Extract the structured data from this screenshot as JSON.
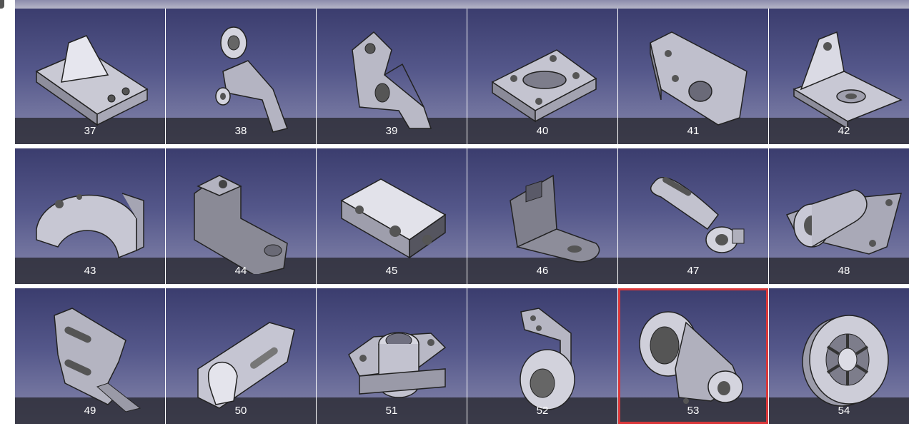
{
  "gallery": {
    "selected_index": 16,
    "accent_color": "#d9373a",
    "tiles": [
      {
        "label": "37",
        "icon": "part-37-icon"
      },
      {
        "label": "38",
        "icon": "part-38-icon"
      },
      {
        "label": "39",
        "icon": "part-39-icon"
      },
      {
        "label": "40",
        "icon": "part-40-icon"
      },
      {
        "label": "41",
        "icon": "part-41-icon"
      },
      {
        "label": "42",
        "icon": "part-42-icon"
      },
      {
        "label": "43",
        "icon": "part-43-icon"
      },
      {
        "label": "44",
        "icon": "part-44-icon"
      },
      {
        "label": "45",
        "icon": "part-45-icon"
      },
      {
        "label": "46",
        "icon": "part-46-icon"
      },
      {
        "label": "47",
        "icon": "part-47-icon"
      },
      {
        "label": "48",
        "icon": "part-48-icon"
      },
      {
        "label": "49",
        "icon": "part-49-icon"
      },
      {
        "label": "50",
        "icon": "part-50-icon"
      },
      {
        "label": "51",
        "icon": "part-51-icon"
      },
      {
        "label": "52",
        "icon": "part-52-icon"
      },
      {
        "label": "53",
        "icon": "part-53-icon"
      },
      {
        "label": "54",
        "icon": "part-54-icon"
      }
    ]
  }
}
